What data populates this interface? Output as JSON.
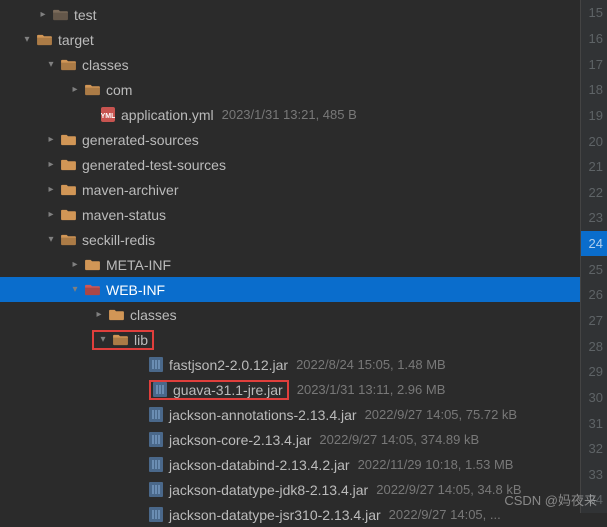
{
  "gutter": [
    "15",
    "16",
    "17",
    "18",
    "19",
    "20",
    "21",
    "22",
    "23",
    "24",
    "25",
    "26",
    "27",
    "28",
    "29",
    "30",
    "31",
    "32",
    "33",
    "34"
  ],
  "gutter_active_index": 9,
  "watermark": "CSDN @妈夜来",
  "rows": [
    {
      "indent": 36,
      "type": "folder-open",
      "chev": "right",
      "label": "test",
      "color": "#7b6b5b"
    },
    {
      "indent": 20,
      "type": "folder-open",
      "chev": "down",
      "label": "target",
      "color": "#d19656"
    },
    {
      "indent": 44,
      "type": "folder-open",
      "chev": "down",
      "label": "classes",
      "color": "#d19656"
    },
    {
      "indent": 68,
      "type": "folder-open",
      "chev": "right",
      "label": "com",
      "color": "#d19656"
    },
    {
      "indent": 84,
      "type": "yml",
      "chev": "",
      "label": "application.yml",
      "meta": "2023/1/31 13:21, 485 B"
    },
    {
      "indent": 44,
      "type": "folder-closed",
      "chev": "right",
      "label": "generated-sources",
      "color": "#d19656"
    },
    {
      "indent": 44,
      "type": "folder-closed",
      "chev": "right",
      "label": "generated-test-sources",
      "color": "#d19656"
    },
    {
      "indent": 44,
      "type": "folder-closed",
      "chev": "right",
      "label": "maven-archiver",
      "color": "#d19656"
    },
    {
      "indent": 44,
      "type": "folder-closed",
      "chev": "right",
      "label": "maven-status",
      "color": "#d19656"
    },
    {
      "indent": 44,
      "type": "folder-open",
      "chev": "down",
      "label": "seckill-redis",
      "color": "#d19656"
    },
    {
      "indent": 68,
      "type": "folder-closed",
      "chev": "right",
      "label": "META-INF",
      "color": "#d19656"
    },
    {
      "indent": 68,
      "type": "folder-open",
      "chev": "down",
      "label": "WEB-INF",
      "selected": true,
      "color": "#d05757"
    },
    {
      "indent": 92,
      "type": "folder-closed",
      "chev": "right",
      "label": "classes",
      "color": "#d19656"
    },
    {
      "indent": 92,
      "type": "folder-open",
      "chev": "down",
      "label": "lib",
      "color": "#d19656",
      "highlight": "row-chev"
    },
    {
      "indent": 132,
      "type": "jar",
      "chev": "",
      "label": "fastjson2-2.0.12.jar",
      "meta": "2022/8/24 15:05, 1.48 MB"
    },
    {
      "indent": 132,
      "type": "jar",
      "chev": "",
      "label": "guava-31.1-jre.jar",
      "meta": "2023/1/31 13:11, 2.96 MB",
      "highlight": "row-label"
    },
    {
      "indent": 132,
      "type": "jar",
      "chev": "",
      "label": "jackson-annotations-2.13.4.jar",
      "meta": "2022/9/27 14:05, 75.72 kB"
    },
    {
      "indent": 132,
      "type": "jar",
      "chev": "",
      "label": "jackson-core-2.13.4.jar",
      "meta": "2022/9/27 14:05, 374.89 kB"
    },
    {
      "indent": 132,
      "type": "jar",
      "chev": "",
      "label": "jackson-databind-2.13.4.2.jar",
      "meta": "2022/11/29 10:18, 1.53 MB"
    },
    {
      "indent": 132,
      "type": "jar",
      "chev": "",
      "label": "jackson-datatype-jdk8-2.13.4.jar",
      "meta": "2022/9/27 14:05, 34.8 kB"
    },
    {
      "indent": 132,
      "type": "jar",
      "chev": "",
      "label": "jackson-datatype-jsr310-2.13.4.jar",
      "meta": "2022/9/27 14:05, ..."
    }
  ]
}
